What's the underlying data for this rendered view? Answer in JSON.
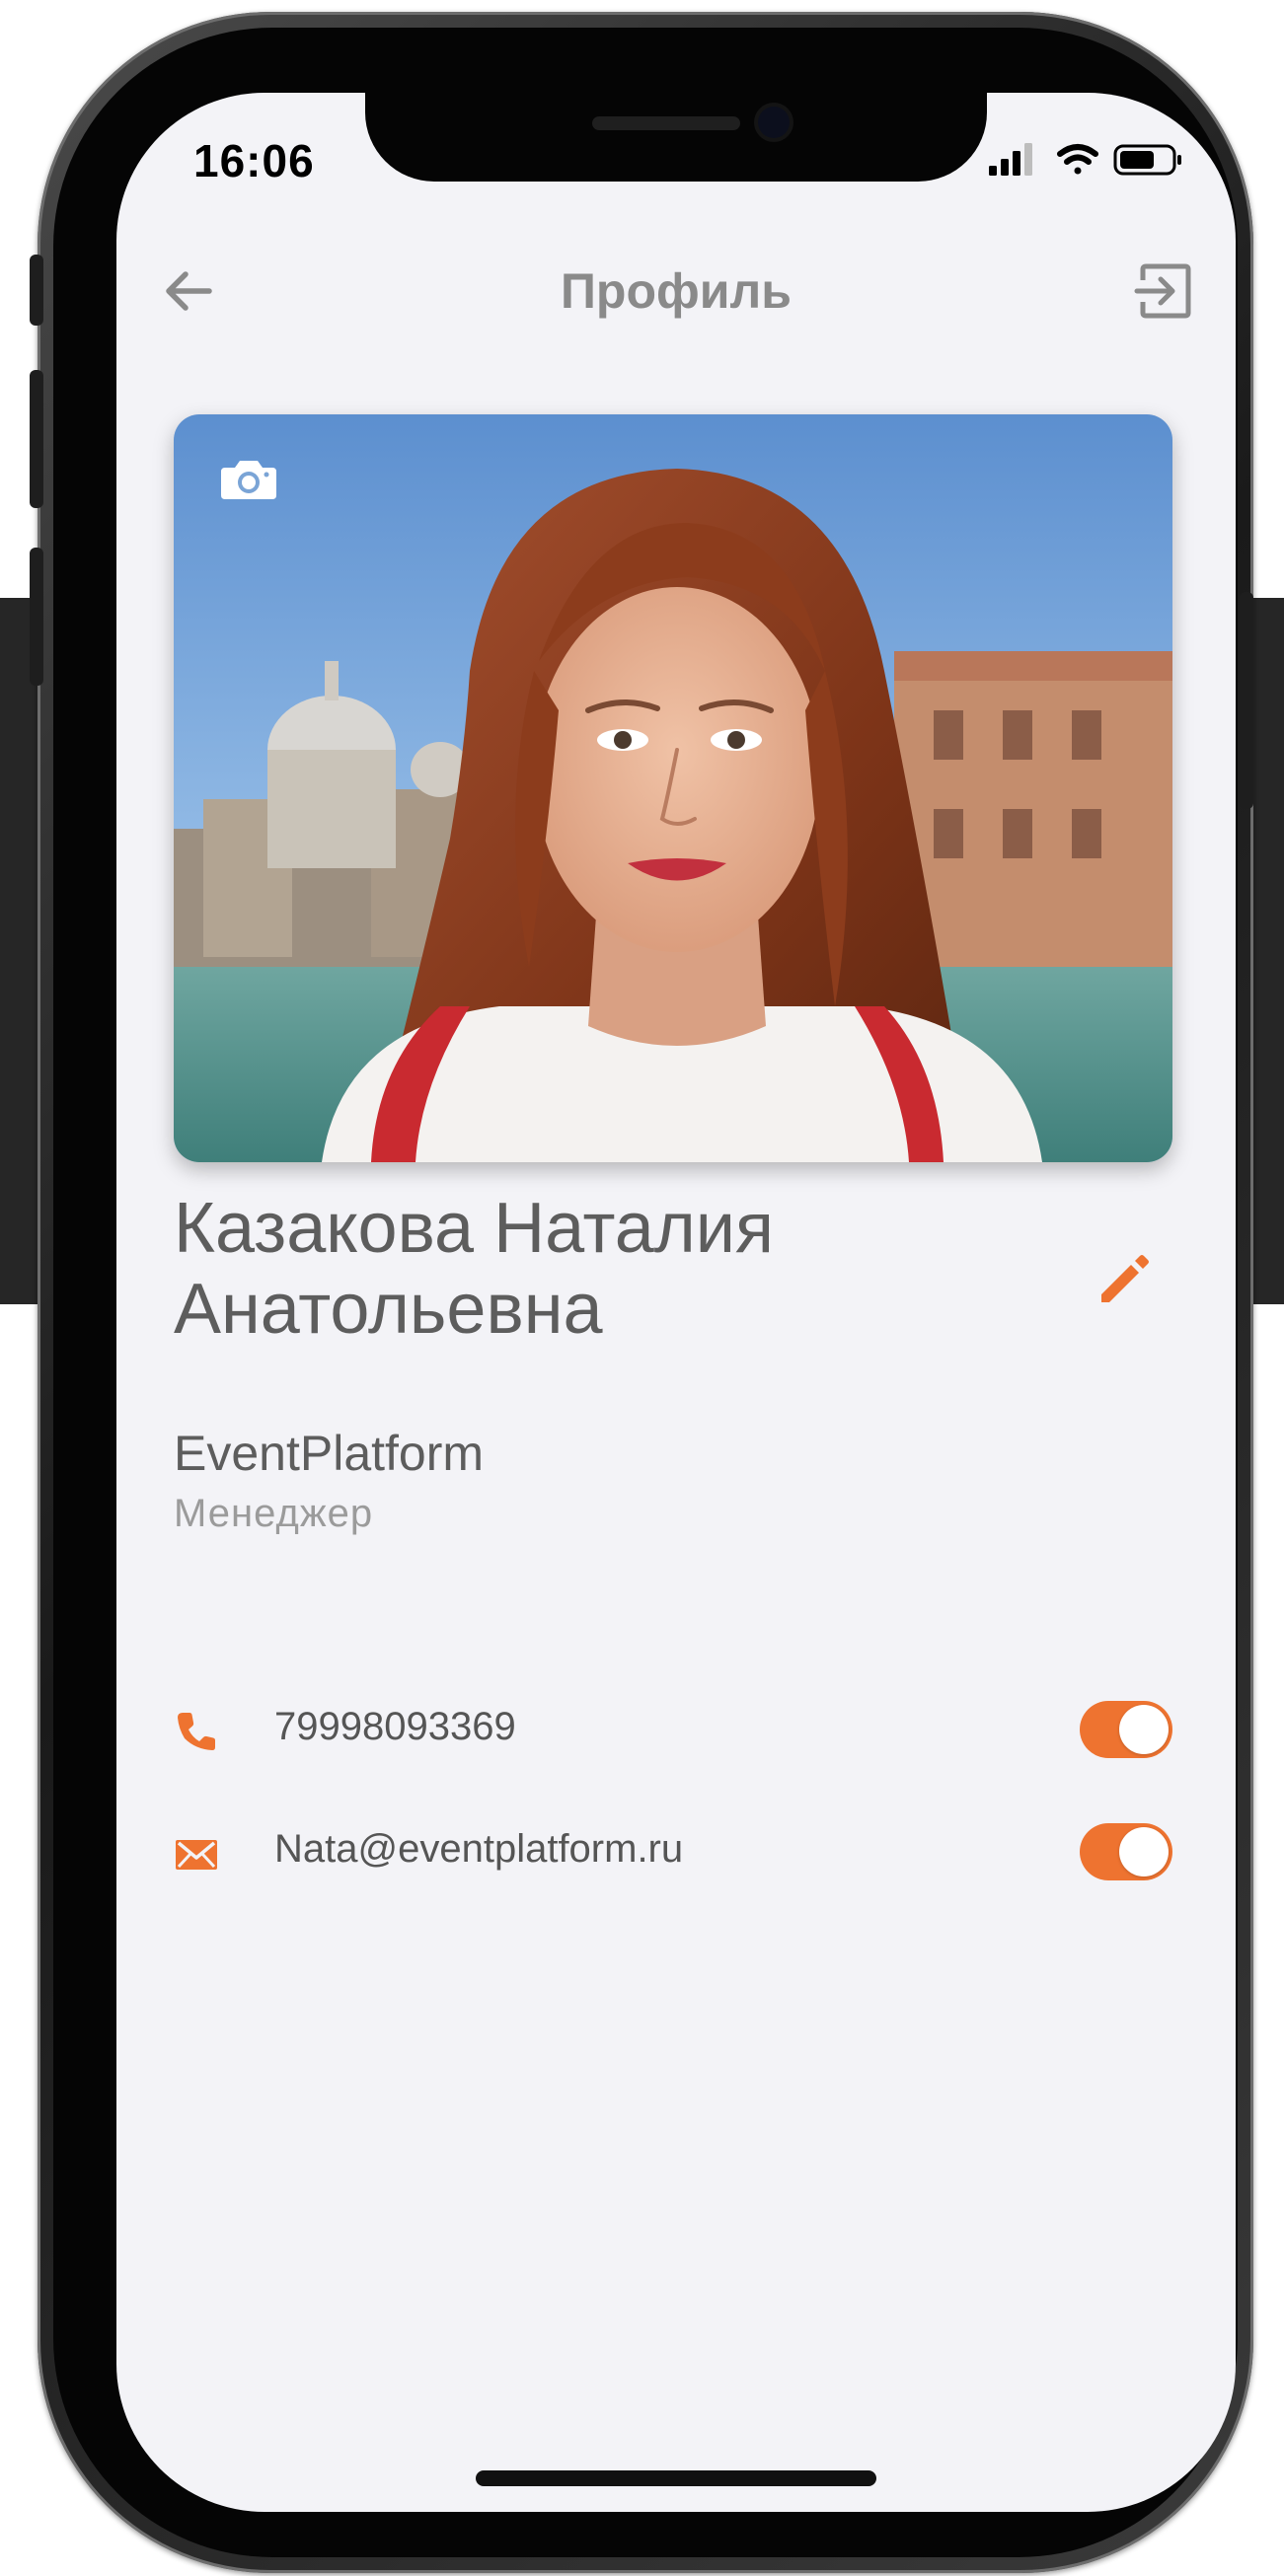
{
  "status_bar": {
    "time": "16:06",
    "icons": [
      "signal-icon",
      "wifi-icon",
      "battery-icon"
    ]
  },
  "nav": {
    "title": "Профиль",
    "back_icon": "arrow-left-icon",
    "logout_icon": "logout-icon"
  },
  "profile": {
    "name_line1": "Казакова Наталия",
    "name_line2": "Анатольевна",
    "company": "EventPlatform",
    "position": "Менеджер",
    "photo_icon": "camera-icon",
    "edit_icon": "pencil-icon"
  },
  "contacts": [
    {
      "icon": "phone-icon",
      "value": "79998093369",
      "enabled": true
    },
    {
      "icon": "mail-icon",
      "value": "Nata@eventplatform.ru",
      "enabled": true
    }
  ],
  "colors": {
    "accent": "#ee7330",
    "screen_background": "#f3f3f7",
    "title_text": "#8a8a8a",
    "body_text": "#5d5d5d",
    "secondary_text": "#9b9b9b"
  }
}
